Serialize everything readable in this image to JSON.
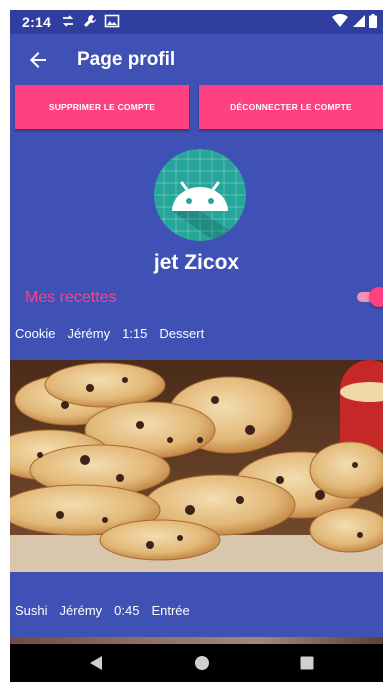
{
  "status_bar": {
    "time": "2:14",
    "left_icons": [
      "data-sync-icon",
      "wrench-icon",
      "gallery-icon"
    ],
    "right_icons": [
      "wifi-icon",
      "signal-icon",
      "battery-icon"
    ]
  },
  "app_bar": {
    "title": "Page profil",
    "back_icon": "arrow-back-icon"
  },
  "actions": {
    "delete_account": "SUPPRIMER LE COMPTE",
    "logout": "DÉCONNECTER LE COMPTE"
  },
  "profile": {
    "username": "jet Zicox",
    "avatar_icon": "android-icon"
  },
  "recipes_section": {
    "title": "Mes recettes",
    "toggle_on": true
  },
  "recipes": [
    {
      "name": "Cookie",
      "author": "Jérémy",
      "duration": "1:15",
      "category": "Dessert"
    },
    {
      "name": "Sushi",
      "author": "Jérémy",
      "duration": "0:45",
      "category": "Entrée"
    }
  ],
  "colors": {
    "primary": "#3f51b5",
    "primary_dark": "#303f9f",
    "accent": "#ff4081",
    "avatar_bg": "#26a69a"
  },
  "nav_bar": {
    "icons": [
      "nav-back-icon",
      "nav-home-icon",
      "nav-recents-icon"
    ]
  }
}
